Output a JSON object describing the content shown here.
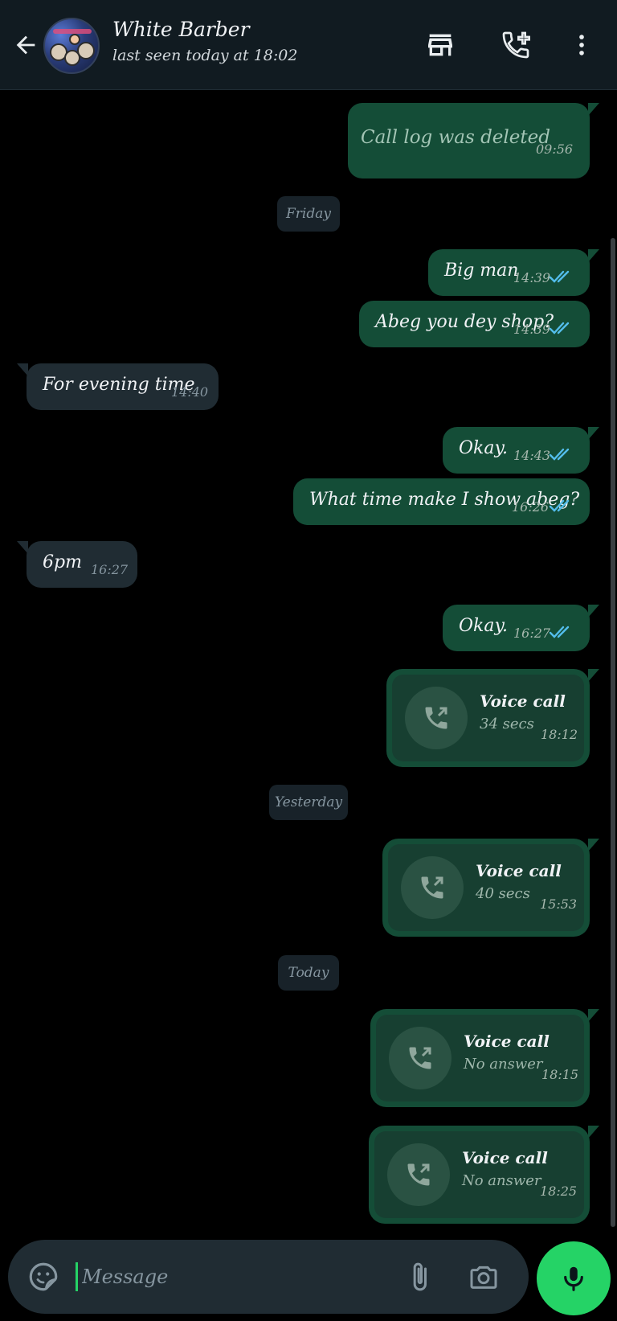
{
  "header": {
    "contact_name": "White Barber",
    "status": "last seen today at 18:02",
    "icons": [
      "back-arrow-icon",
      "store-icon",
      "add-call-icon",
      "more-vert-icon"
    ]
  },
  "colors": {
    "header_bg": "#111b21",
    "chat_bg": "#000000",
    "outgoing_bubble": "#144d37",
    "incoming_bubble": "#202c33",
    "read_ticks": "#53bdeb",
    "accent": "#25d366"
  },
  "messages": [
    {
      "text": "Call log was deleted",
      "time": "09:56",
      "direction": "out",
      "deleted": true
    },
    {
      "text": "Big man",
      "time": "14:39",
      "direction": "out",
      "status": "read"
    },
    {
      "text": "Abeg you dey shop?",
      "time": "14:39",
      "direction": "out",
      "status": "read"
    },
    {
      "text": "For evening time",
      "time": "14:40",
      "direction": "in"
    },
    {
      "text": "Okay.",
      "time": "14:43",
      "direction": "out",
      "status": "read"
    },
    {
      "text": "What time make I show abeg?",
      "time": "16:26",
      "direction": "out",
      "status": "read"
    },
    {
      "text": "6pm",
      "time": "16:27",
      "direction": "in"
    },
    {
      "text": "Okay.",
      "time": "16:27",
      "direction": "out",
      "status": "read"
    }
  ],
  "date_chips": [
    "Friday",
    "Yesterday",
    "Today"
  ],
  "calls": [
    {
      "title": "Voice call",
      "detail": "34 secs",
      "time": "18:12"
    },
    {
      "title": "Voice call",
      "detail": "40 secs",
      "time": "15:53"
    },
    {
      "title": "Voice call",
      "detail": "No answer",
      "time": "18:15"
    },
    {
      "title": "Voice call",
      "detail": "No answer",
      "time": "18:25"
    }
  ],
  "composer": {
    "placeholder": "Message",
    "value": ""
  }
}
